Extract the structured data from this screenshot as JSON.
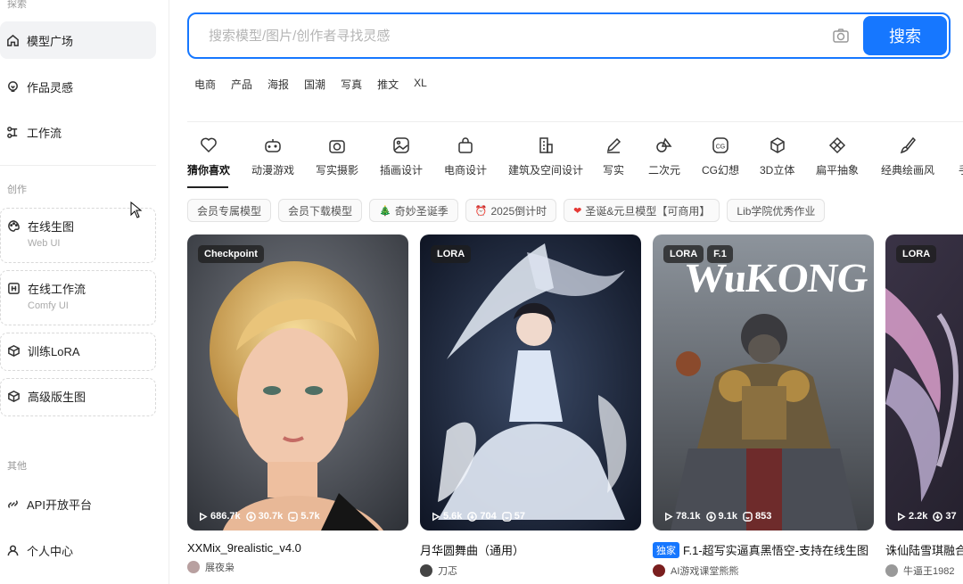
{
  "sidebar": {
    "section_top": "探索",
    "section_create": "创作",
    "section_other": "其他",
    "items": [
      {
        "label": "模型广场"
      },
      {
        "label": "作品灵感"
      },
      {
        "label": "工作流"
      },
      {
        "label": "在线生图",
        "sub": "Web UI"
      },
      {
        "label": "在线工作流",
        "sub": "Comfy UI"
      },
      {
        "label": "训练LoRA"
      },
      {
        "label": "高级版生图"
      },
      {
        "label": "API开放平台"
      },
      {
        "label": "个人中心"
      }
    ]
  },
  "search": {
    "placeholder": "搜索模型/图片/创作者寻找灵感",
    "button": "搜索"
  },
  "hot_tags": [
    "电商",
    "产品",
    "海报",
    "国潮",
    "写真",
    "推文",
    "XL"
  ],
  "categories": [
    {
      "label": "猜你喜欢",
      "icon": "heart-icon"
    },
    {
      "label": "动漫游戏",
      "icon": "gamepad-icon"
    },
    {
      "label": "写实摄影",
      "icon": "camera-icon"
    },
    {
      "label": "插画设计",
      "icon": "picture-icon"
    },
    {
      "label": "电商设计",
      "icon": "bag-icon"
    },
    {
      "label": "建筑及空间设计",
      "icon": "building-icon"
    },
    {
      "label": "写实",
      "icon": "pen-icon"
    },
    {
      "label": "二次元",
      "icon": "shapes-icon"
    },
    {
      "label": "CG幻想",
      "icon": "cg-icon"
    },
    {
      "label": "3D立体",
      "icon": "cube-icon"
    },
    {
      "label": "扁平抽象",
      "icon": "flat-icon"
    },
    {
      "label": "经典绘画风",
      "icon": "brush-icon"
    },
    {
      "label": "手",
      "icon": "more-icon"
    }
  ],
  "pills": [
    {
      "label": "会员专属模型",
      "icon": ""
    },
    {
      "label": "会员下载模型",
      "icon": ""
    },
    {
      "label": "奇妙圣诞季",
      "icon": "🎄"
    },
    {
      "label": "2025倒计时",
      "icon": "⏰"
    },
    {
      "label": "圣诞&元旦模型【可商用】",
      "icon": "❤"
    },
    {
      "label": "Lib学院优秀作业",
      "icon": ""
    }
  ],
  "cards": [
    {
      "badges": [
        "Checkpoint"
      ],
      "views": "686.7k",
      "downloads": "30.7k",
      "likes": "5.7k",
      "title": "XXMix_9realistic_v4.0",
      "exclusive": "",
      "author": "展夜枭"
    },
    {
      "badges": [
        "LORA"
      ],
      "views": "5.6k",
      "downloads": "704",
      "likes": "57",
      "title": "月华圆舞曲（通用）",
      "exclusive": "",
      "author": "刀忑"
    },
    {
      "badges": [
        "LORA",
        "F.1"
      ],
      "views": "78.1k",
      "downloads": "9.1k",
      "likes": "853",
      "title": "F.1-超写实逼真黑悟空-支持在线生图",
      "exclusive": "独家",
      "author": "AI游戏课堂熊熊",
      "overlay_text": "WuKONG"
    },
    {
      "badges": [
        "LORA"
      ],
      "views": "2.2k",
      "downloads": "37",
      "likes": "",
      "title": "诛仙陆雪琪融合",
      "exclusive": "",
      "author": "牛逼王1982"
    }
  ],
  "colors": {
    "accent": "#1677ff"
  }
}
